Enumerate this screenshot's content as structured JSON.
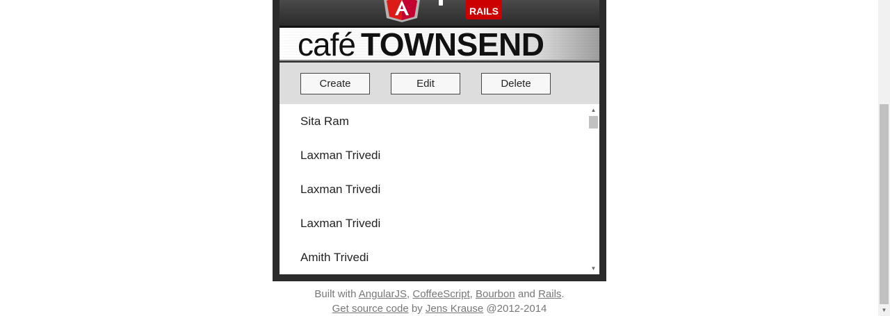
{
  "header": {
    "logos": [
      "angularjs-logo",
      "rails-logo"
    ],
    "rails_logo_text": "RAILS",
    "brand_cafe": "café",
    "brand_name": "TOWNSEND"
  },
  "toolbar": {
    "create_label": "Create",
    "edit_label": "Edit",
    "delete_label": "Delete"
  },
  "employees": [
    "Sita Ram",
    "Laxman Trivedi",
    "Laxman Trivedi",
    "Laxman Trivedi",
    "Amith Trivedi"
  ],
  "footer": {
    "built_with": "Built with",
    "angularjs": "AngularJS",
    "coffeescript": "CoffeeScript",
    "bourbon": "Bourbon",
    "and": "and",
    "rails": "Rails",
    "source_link": "Get source code",
    "by": "by",
    "author": "Jens Krause",
    "copyright": "@2012-2014"
  },
  "colors": {
    "frame": "#2b2b2b",
    "toolbar_bg": "#dddddd",
    "angular_red": "#dd1b16",
    "rails_red": "#cc0000"
  }
}
